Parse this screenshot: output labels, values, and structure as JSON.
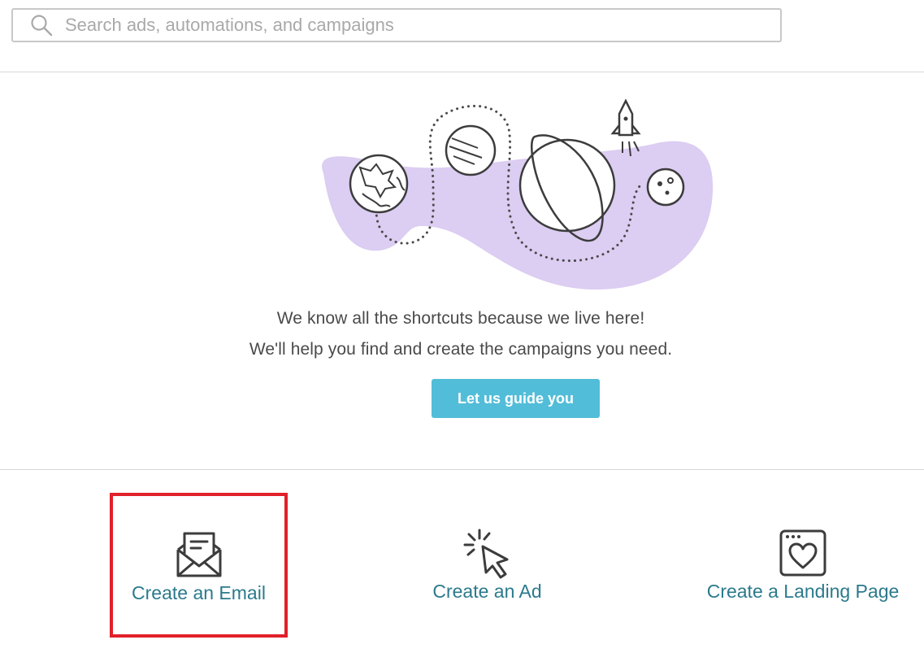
{
  "search": {
    "placeholder": "Search ads, automations, and campaigns",
    "value": ""
  },
  "hero": {
    "line1": "We know all the shortcuts because we live here!",
    "line2": "We'll help you find and create the campaigns you need.",
    "button_label": "Let us guide you"
  },
  "cards": [
    {
      "label": "Create an Email",
      "icon": "envelope-icon",
      "highlighted": true
    },
    {
      "label": "Create an Ad",
      "icon": "cursor-click-icon",
      "highlighted": false
    },
    {
      "label": "Create a Landing Page",
      "icon": "browser-heart-icon",
      "highlighted": false
    }
  ],
  "colors": {
    "accent_button": "#52bdd8",
    "link_text": "#2b7a8c",
    "highlight_border": "#e0202a",
    "illustration_blob": "#dccdf2"
  }
}
